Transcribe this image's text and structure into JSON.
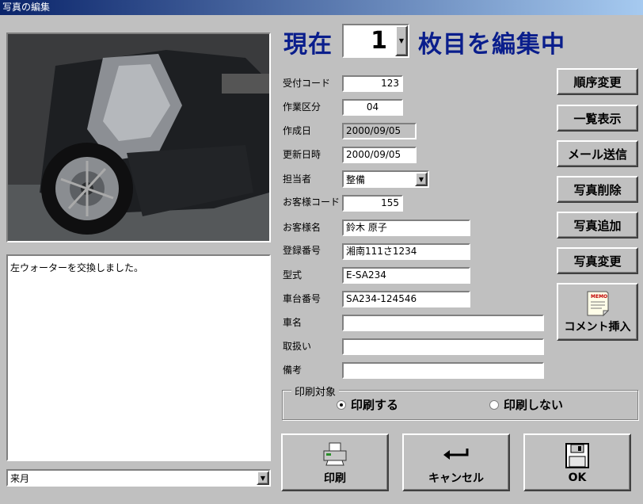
{
  "window": {
    "title": "写真の編集"
  },
  "header": {
    "prefix": "現在",
    "page_number": "1",
    "suffix": "枚目を編集中"
  },
  "memo": {
    "text": "左ウォーターを交換しました。"
  },
  "month_select": {
    "value": "来月"
  },
  "form": {
    "reception_code": {
      "label": "受付コード",
      "value": "123"
    },
    "work_category": {
      "label": "作業区分",
      "value": "04"
    },
    "created_date": {
      "label": "作成日",
      "value": "2000/09/05"
    },
    "updated_date": {
      "label": "更新日時",
      "value": "2000/09/05"
    },
    "staff": {
      "label": "担当者",
      "value": "整備"
    },
    "customer_code": {
      "label": "お客様コード",
      "value": "155"
    },
    "customer_name": {
      "label": "お客様名",
      "value": "鈴木 原子"
    },
    "registration_number": {
      "label": "登録番号",
      "value": "湘南111さ1234"
    },
    "model": {
      "label": "型式",
      "value": "E-SA234"
    },
    "chassis_number": {
      "label": "車台番号",
      "value": "SA234-124546"
    },
    "car_name": {
      "label": "車名",
      "value": ""
    },
    "handling": {
      "label": "取扱い",
      "value": ""
    },
    "remarks": {
      "label": "備考",
      "value": ""
    }
  },
  "side_buttons": {
    "reorder": "順序変更",
    "list_view": "一覧表示",
    "send_mail": "メール送信",
    "delete_photo": "写真削除",
    "add_photo": "写真追加",
    "change_photo": "写真変更",
    "insert_comment": "コメント挿入",
    "memo_icon_text": "MEMO"
  },
  "print_group": {
    "title": "印刷対象",
    "option_print": "印刷する",
    "option_no_print": "印刷しない",
    "selected": "印刷する"
  },
  "bottom_buttons": {
    "print": "印刷",
    "cancel": "キャンセル",
    "ok": "OK"
  },
  "icons": {
    "page_dropdown": "chevron-down-icon",
    "staff_dropdown": "chevron-down-icon",
    "month_dropdown": "chevron-down-icon",
    "memo": "memo-icon",
    "printer": "printer-icon",
    "return": "return-arrow-icon",
    "save": "floppy-disk-icon"
  },
  "colors": {
    "title_bar": "#0a246a",
    "heading": "#0a1e8c",
    "face": "#c0c0c0"
  }
}
